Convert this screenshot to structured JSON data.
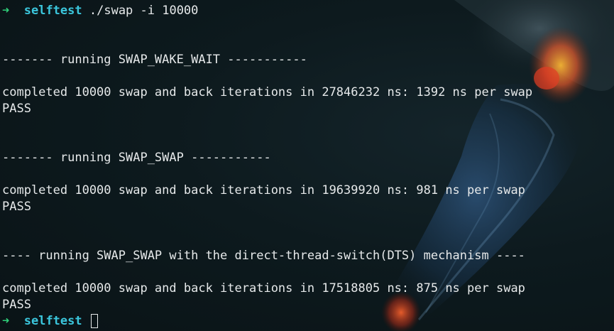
{
  "prompt": {
    "arrow": "➜",
    "directory": "selftest"
  },
  "command": "./swap -i 10000",
  "output": {
    "blank_1": "",
    "blank_2": "",
    "section_1_header": "------- running SWAP_WAKE_WAIT -----------",
    "blank_3": "",
    "section_1_result": "completed 10000 swap and back iterations in 27846232 ns: 1392 ns per swap",
    "section_1_status": "PASS",
    "blank_4": "",
    "blank_5": "",
    "section_2_header": "------- running SWAP_SWAP -----------",
    "blank_6": "",
    "section_2_result": "completed 10000 swap and back iterations in 19639920 ns: 981 ns per swap",
    "section_2_status": "PASS",
    "blank_7": "",
    "blank_8": "",
    "section_3_header": "---- running SWAP_SWAP with the direct-thread-switch(DTS) mechanism ----",
    "blank_9": "",
    "section_3_result": "completed 10000 swap and back iterations in 17518805 ns: 875 ns per swap",
    "section_3_status": "PASS"
  },
  "colors": {
    "prompt_arrow": "#2fd07a",
    "prompt_directory": "#3bc6dc",
    "text": "#e6e9ea",
    "background": "#0b1519"
  }
}
